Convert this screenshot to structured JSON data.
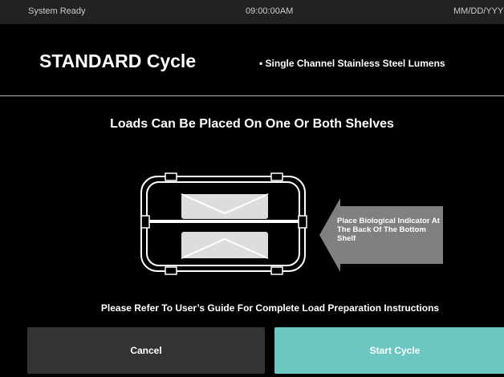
{
  "status_bar": {
    "left_text": "System Ready",
    "center_text": "09:00:00AM",
    "right_text": "MM/DD/YYYY"
  },
  "header": {
    "title": "STANDARD Cycle",
    "subtitle": "• Single Channel Stainless Steel Lumens"
  },
  "main": {
    "instruction": "Loads Can Be Placed On One Or Both Shelves",
    "callout": "Place Biological Indicator At The Back Of The Bottom Shelf",
    "footer_note": "Please Refer To User’s Guide For Complete Load Preparation Instructions"
  },
  "actions": {
    "cancel_label": "Cancel",
    "start_label": "Start Cycle"
  },
  "colors": {
    "start_button": "#6cc7c2",
    "cancel_button": "#333333",
    "callout_arrow": "#808080"
  }
}
